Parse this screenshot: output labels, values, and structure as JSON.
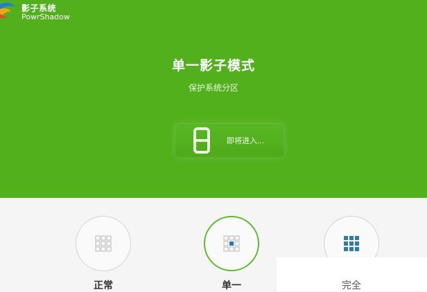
{
  "app": {
    "brand_cn": "影子系统",
    "brand_en": "PowrShadow"
  },
  "mode": {
    "title": "单一影子模式",
    "subtitle": "保护系统分区"
  },
  "status": {
    "digit": "8",
    "text": "即将进入..."
  },
  "modes": [
    {
      "label": "正常",
      "icon": "grid-gray-icon",
      "active": false
    },
    {
      "label": "单一",
      "icon": "grid-center-blue-icon",
      "active": true
    },
    {
      "label": "完全",
      "icon": "grid-full-blue-icon",
      "active": false
    }
  ],
  "colors": {
    "green": "#52b01c",
    "active_ring": "#5fba2a",
    "blue": "#2f77b5",
    "gray": "#bdbdbd"
  }
}
